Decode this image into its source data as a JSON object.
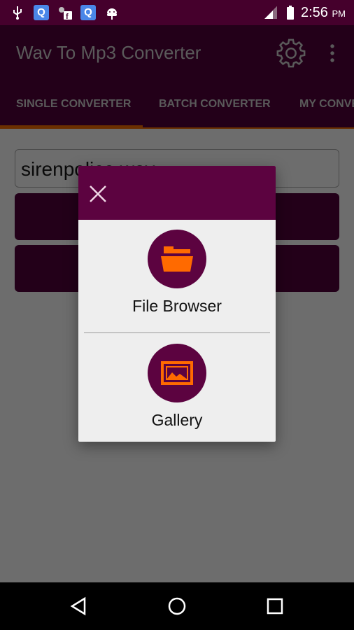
{
  "status_bar": {
    "time": "2:56",
    "ampm": "PM",
    "icons": [
      "usb-icon",
      "search-app-icon",
      "facebook-notification-icon",
      "search-app-icon",
      "android-icon",
      "signal-icon",
      "battery-icon"
    ]
  },
  "app_bar": {
    "title": "Wav To Mp3 Converter",
    "settings_icon": "gear-icon",
    "menu_icon": "more-vert-icon"
  },
  "tabs": [
    {
      "label": "SINGLE CONVERTER",
      "selected": true
    },
    {
      "label": "BATCH CONVERTER"
    },
    {
      "label": "MY CONVERSIONS"
    }
  ],
  "main": {
    "file_input_value": "sirenpolice.wav"
  },
  "dialog": {
    "close_icon": "close-icon",
    "options": [
      {
        "label": "File Browser",
        "icon": "folder-open-icon"
      },
      {
        "label": "Gallery",
        "icon": "image-icon"
      }
    ]
  },
  "colors": {
    "accent": "#ff6a00",
    "primary": "#5c0340"
  }
}
